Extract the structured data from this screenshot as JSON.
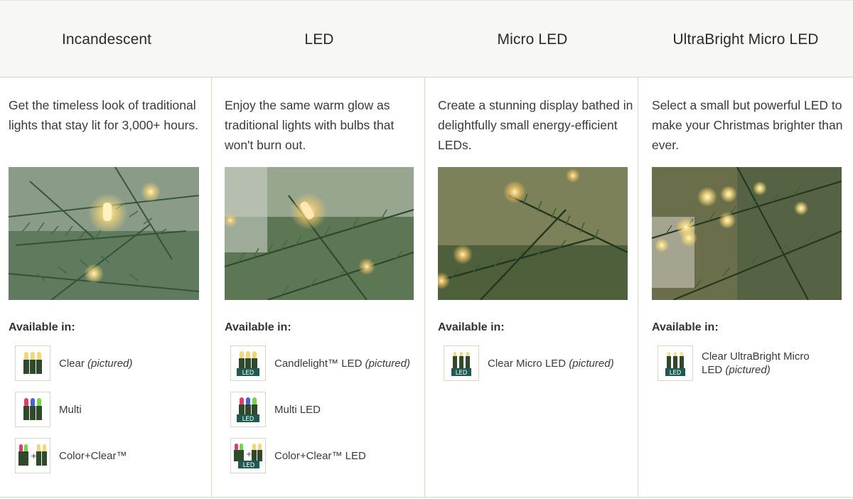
{
  "columns": [
    {
      "title": "Incandescent",
      "description": "Get the timeless look of traditional lights that stay lit for 3,000+ hours.",
      "available_label": "Available in:",
      "options": [
        {
          "label": "Clear",
          "note": "(pictured)",
          "icon": "clear-bulbs-icon"
        },
        {
          "label": "Multi",
          "note": "",
          "icon": "multi-bulbs-icon"
        },
        {
          "label": "Color+Clear™",
          "note": "",
          "icon": "color-clear-bulbs-icon"
        }
      ]
    },
    {
      "title": "LED",
      "description": "Enjoy the same warm glow as traditional lights with bulbs that won't burn out.",
      "available_label": "Available in:",
      "options": [
        {
          "label": "Candlelight™ LED",
          "note": "(pictured)",
          "icon": "candlelight-led-icon"
        },
        {
          "label": "Multi LED",
          "note": "",
          "icon": "multi-led-icon"
        },
        {
          "label": "Color+Clear™ LED",
          "note": "",
          "icon": "color-clear-led-icon"
        }
      ]
    },
    {
      "title": "Micro LED",
      "description": "Create a stunning display bathed in delightfully small energy-efficient LEDs.",
      "available_label": "Available in:",
      "options": [
        {
          "label": "Clear Micro LED",
          "note": "(pictured)",
          "icon": "clear-micro-led-icon"
        }
      ]
    },
    {
      "title": "UltraBright Micro LED",
      "description": "Select a small but powerful LED to make your Christmas brighter than ever.",
      "available_label": "Available in:",
      "options": [
        {
          "label": "Clear UltraBright Micro LED",
          "note": "(pictured)",
          "icon": "clear-ultrabright-led-icon"
        }
      ]
    }
  ],
  "colors": {
    "header_bg": "#f7f7f6",
    "divider": "#d9d6c5",
    "wire_green": "#2f4a2a",
    "warm_bulb": "#f3d67a",
    "led_base": "#1f5a52"
  },
  "led_badge": "LED"
}
